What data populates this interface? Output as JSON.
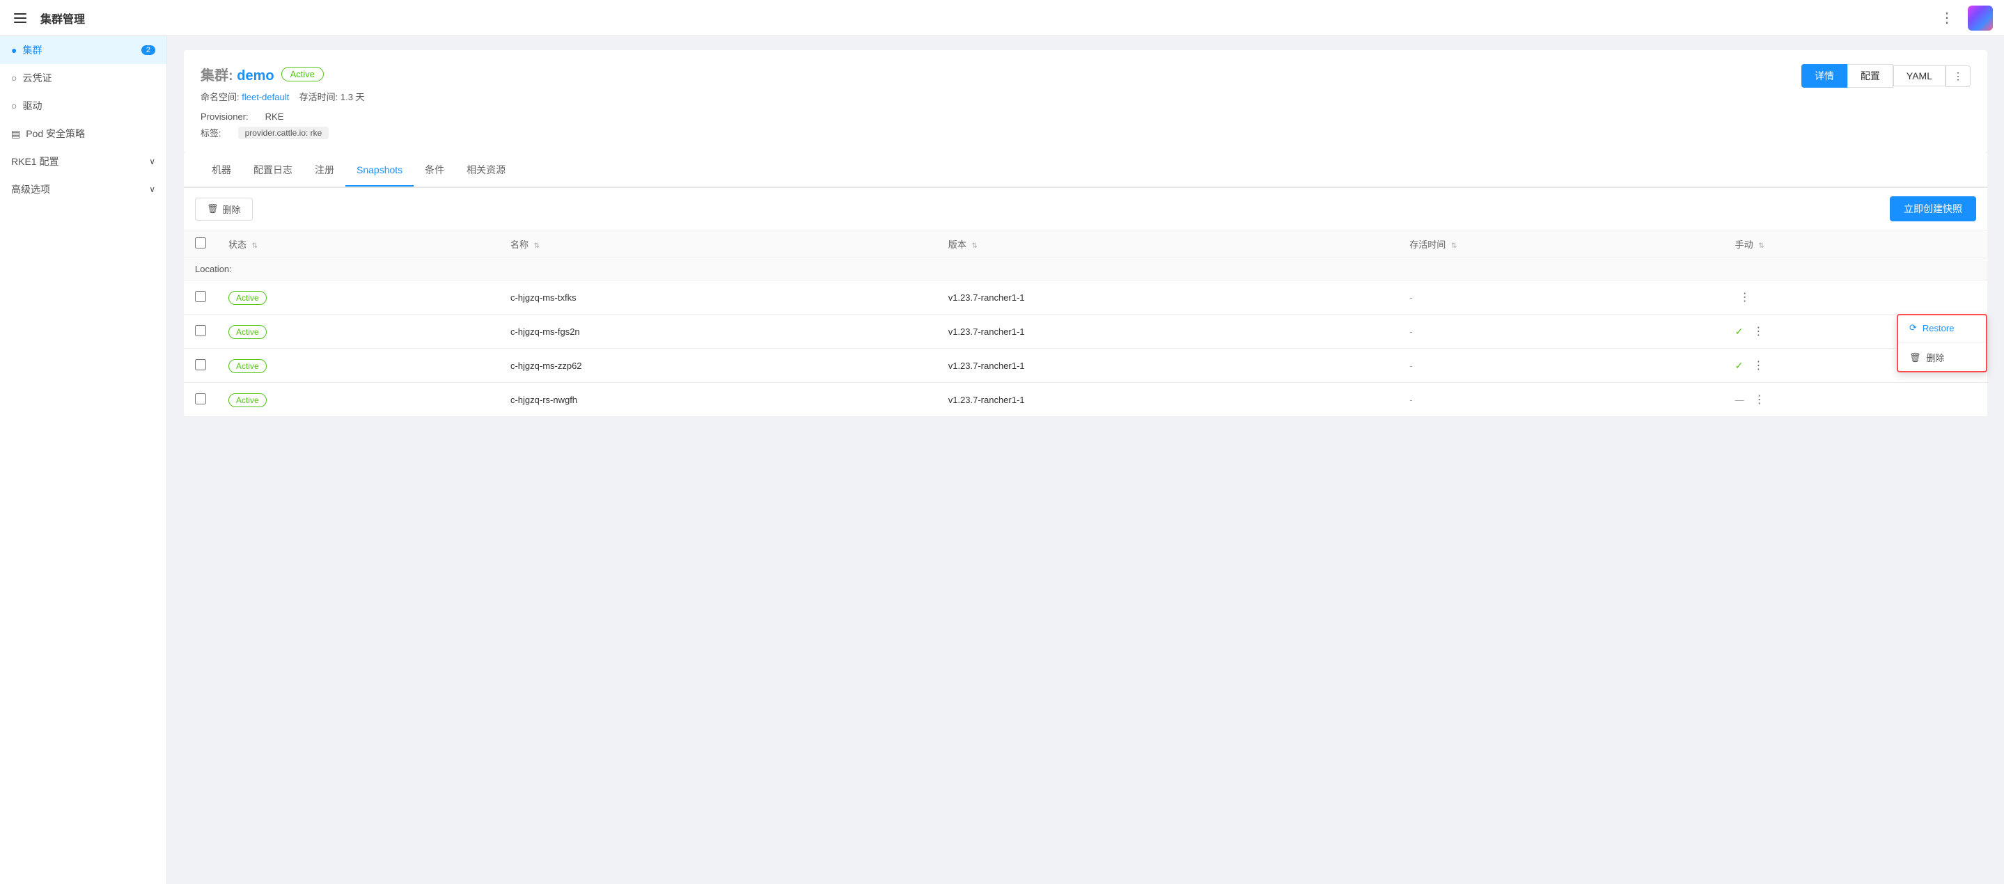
{
  "topBar": {
    "title": "集群管理",
    "menuIcon": "≡"
  },
  "sidebar": {
    "items": [
      {
        "id": "clusters",
        "label": "集群",
        "badge": "2",
        "active": true,
        "icon": "○"
      },
      {
        "id": "cloud-credentials",
        "label": "云凭证",
        "icon": "○"
      },
      {
        "id": "drivers",
        "label": "驱动",
        "icon": "○"
      },
      {
        "id": "pod-security",
        "label": "Pod 安全策略",
        "icon": "▤"
      },
      {
        "id": "rke1-config",
        "label": "RKE1 配置",
        "hasChevron": true
      },
      {
        "id": "advanced",
        "label": "高级选项",
        "hasChevron": true
      }
    ]
  },
  "clusterDetail": {
    "titleLabel": "集群:",
    "clusterName": "demo",
    "statusBadge": "Active",
    "namespace": "fleet-default",
    "namespaceLabel": "命名空间:",
    "uptime": "1.3 天",
    "uptimeLabel": "存活时间:",
    "provisionerLabel": "Provisioner:",
    "provisionerValue": "RKE",
    "tagLabel": "标签:",
    "tag": "provider.cattle.io: rke"
  },
  "headerActions": {
    "details": "详情",
    "config": "配置",
    "yaml": "YAML",
    "moreIcon": "⋮"
  },
  "tabs": [
    {
      "id": "machines",
      "label": "机器"
    },
    {
      "id": "config-log",
      "label": "配置日志"
    },
    {
      "id": "register",
      "label": "注册"
    },
    {
      "id": "snapshots",
      "label": "Snapshots",
      "active": true
    },
    {
      "id": "conditions",
      "label": "条件"
    },
    {
      "id": "related",
      "label": "相关资源"
    }
  ],
  "tableToolbar": {
    "deleteBtn": "删除",
    "createBtn": "立即创建快照"
  },
  "tableHeaders": [
    {
      "id": "status",
      "label": "状态"
    },
    {
      "id": "name",
      "label": "名称"
    },
    {
      "id": "version",
      "label": "版本"
    },
    {
      "id": "uptime",
      "label": "存活时间"
    },
    {
      "id": "manual",
      "label": "手动"
    }
  ],
  "locationRow": {
    "label": "Location:"
  },
  "tableRows": [
    {
      "id": 1,
      "status": "Active",
      "name": "c-hjgzq-ms-txfks",
      "version": "v1.23.7-rancher1-1",
      "uptime": "-",
      "manual": "",
      "showMenu": true,
      "menuOpen": true
    },
    {
      "id": 2,
      "status": "Active",
      "name": "c-hjgzq-ms-fgs2n",
      "version": "v1.23.7-rancher1-1",
      "uptime": "-",
      "manual": "✓",
      "showMenu": true,
      "menuOpen": false
    },
    {
      "id": 3,
      "status": "Active",
      "name": "c-hjgzq-ms-zzp62",
      "version": "v1.23.7-rancher1-1",
      "uptime": "-",
      "manual": "✓",
      "showMenu": true,
      "menuOpen": false
    },
    {
      "id": 4,
      "status": "Active",
      "name": "c-hjgzq-rs-nwgfh",
      "version": "v1.23.7-rancher1-1",
      "uptime": "-",
      "manual": "—",
      "showMenu": true,
      "menuOpen": false
    }
  ],
  "contextMenu": {
    "restoreLabel": "Restore",
    "deleteLabel": "删除",
    "restoreIcon": "⟳",
    "deleteIcon": "🗑"
  },
  "colors": {
    "primary": "#1890ff",
    "success": "#52c41a",
    "danger": "#ff4d4f"
  }
}
